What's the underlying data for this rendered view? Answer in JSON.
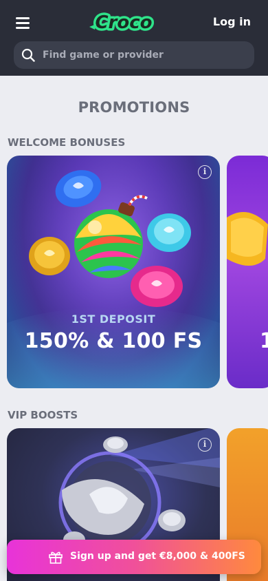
{
  "header": {
    "logo_text": "Croco",
    "login_label": "Log in"
  },
  "search": {
    "placeholder": "Find game or provider",
    "value": ""
  },
  "page": {
    "title": "PROMOTIONS"
  },
  "sections": [
    {
      "title": "WELCOME BONUSES",
      "cards": [
        {
          "label": "1ST DEPOSIT",
          "value": "150% & 100 FS"
        },
        {
          "value": "1"
        }
      ]
    },
    {
      "title": "VIP BOOSTS"
    }
  ],
  "cta": {
    "label": "Sign up and get €8,000 & 400FS"
  },
  "icons": {
    "menu": "hamburger-menu-icon",
    "search": "search-icon",
    "info": "info-icon",
    "gift": "gift-icon"
  },
  "colors": {
    "header_bg": "#2a2d38",
    "page_bg": "#ecedf2",
    "brand_green": "#2fe38a",
    "cta_gradient_start": "#e833d9",
    "cta_gradient_end": "#ff8a3d"
  }
}
